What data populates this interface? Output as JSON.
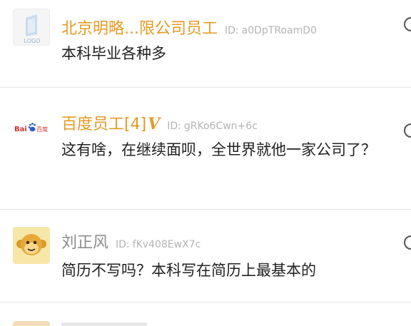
{
  "comments": [
    {
      "username": "北京明略...限公司员工",
      "id_label": "ID:",
      "id_value": "a0DpTRoamD0",
      "text": "本科毕业各种多",
      "avatar": {
        "icon": "logo-placeholder-icon",
        "text": "LOGO"
      }
    },
    {
      "username": "百度员工[4]",
      "badge": "V",
      "id_label": "ID:",
      "id_value": "gRKo6Cwn+6c",
      "text": "这有啥，在继续面呗，全世界就他一家公司了？",
      "avatar": {
        "icon": "baidu-logo-icon",
        "text_bai": "Bai",
        "text_du": "百度"
      }
    },
    {
      "username": "刘正风",
      "id_label": "ID:",
      "id_value": "fKv408EwX7c",
      "text": "简历不写吗？本科写在简历上最基本的",
      "avatar": {
        "icon": "monkey-avatar-icon"
      }
    }
  ],
  "colors": {
    "orange_name": "#e49a24",
    "gray_name": "#8c8c8c",
    "id_gray": "#b4b4b4",
    "divider": "#e3e3e3"
  }
}
